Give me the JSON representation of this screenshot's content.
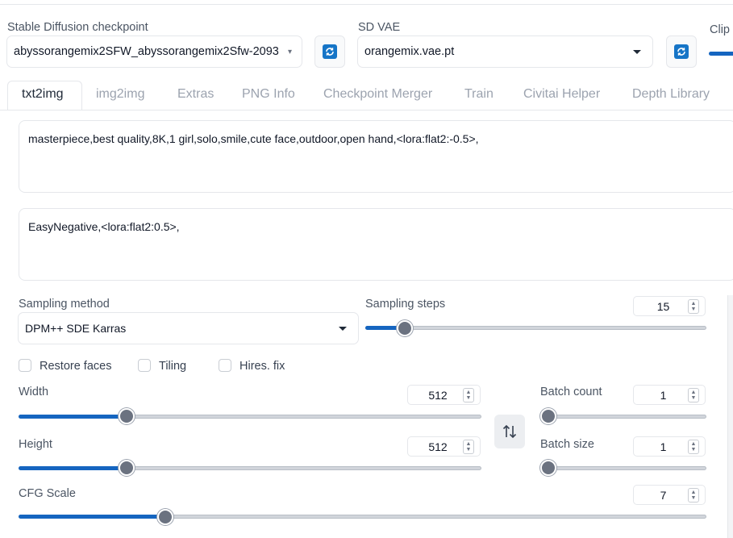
{
  "header": {
    "checkpoint_label": "Stable Diffusion checkpoint",
    "checkpoint_value": "abyssorangemix2SFW_abyssorangemix2Sfw-2093",
    "vae_label": "SD VAE",
    "vae_value": "orangemix.vae.pt",
    "clip_label": "Clip s"
  },
  "tabs": [
    {
      "label": "txt2img",
      "active": true
    },
    {
      "label": "img2img"
    },
    {
      "label": "Extras"
    },
    {
      "label": "PNG Info"
    },
    {
      "label": "Checkpoint Merger"
    },
    {
      "label": "Train"
    },
    {
      "label": "Civitai Helper"
    },
    {
      "label": "Depth Library"
    }
  ],
  "prompt": {
    "positive": "masterpiece,best quality,8K,1 girl,solo,smile,cute face,outdoor,open hand,<lora:flat2:-0.5>,",
    "negative": "EasyNegative,<lora:flat2:0.5>,"
  },
  "sampling": {
    "method_label": "Sampling method",
    "method_value": "DPM++ SDE Karras",
    "steps_label": "Sampling steps",
    "steps_value": "15",
    "steps_fraction": 0.1
  },
  "options": {
    "restore_faces": "Restore faces",
    "tiling": "Tiling",
    "hires_fix": "Hires. fix"
  },
  "size": {
    "width_label": "Width",
    "width_value": "512",
    "width_fraction": 0.235,
    "height_label": "Height",
    "height_value": "512",
    "height_fraction": 0.235
  },
  "batch": {
    "count_label": "Batch count",
    "count_value": "1",
    "size_label": "Batch size",
    "size_value": "1"
  },
  "cfg": {
    "label": "CFG Scale",
    "value": "7",
    "fraction": 0.21
  },
  "colors": {
    "accent": "#1565c0",
    "refresh_icon": "#1675c7"
  }
}
